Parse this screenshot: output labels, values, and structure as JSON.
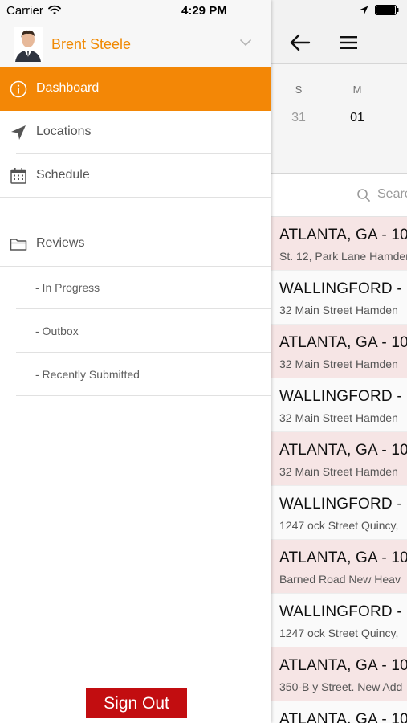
{
  "status_bar": {
    "carrier": "Carrier",
    "time": "4:29 PM"
  },
  "profile": {
    "name": "Brent Steele"
  },
  "nav": {
    "dashboard": "Dashboard",
    "locations": "Locations",
    "schedule": "Schedule",
    "reviews": "Reviews"
  },
  "reviews_sub": {
    "in_progress": "-  In Progress",
    "outbox": "-  Outbox",
    "recently_submitted": "-  Recently Submitted"
  },
  "sign_out": "Sign Out",
  "calendar": {
    "days": [
      {
        "dow": "S",
        "date": "31"
      },
      {
        "dow": "M",
        "date": "01"
      }
    ]
  },
  "search": {
    "placeholder": "Search"
  },
  "sites": [
    {
      "title": "ATLANTA, GA - 10",
      "address": "St. 12,  Park Lane Hamden"
    },
    {
      "title": "WALLINGFORD - ",
      "address": "32 Main Street  Hamden"
    },
    {
      "title": "ATLANTA, GA - 10",
      "address": "32 Main Street  Hamden"
    },
    {
      "title": "WALLINGFORD - ",
      "address": "32 Main Street  Hamden"
    },
    {
      "title": "ATLANTA, GA - 10",
      "address": "32 Main Street  Hamden"
    },
    {
      "title": "WALLINGFORD - ",
      "address": "1247 ock Street  Quincy,"
    },
    {
      "title": "ATLANTA, GA - 10",
      "address": "Barned Road  New Heav"
    },
    {
      "title": "WALLINGFORD - ",
      "address": "1247 ock Street  Quincy,"
    },
    {
      "title": "ATLANTA, GA - 10",
      "address": "350-B y Street. New Add"
    },
    {
      "title": "ATLANTA, GA - 10",
      "address": ""
    }
  ],
  "colors": {
    "accent": "#f38706",
    "sign_out": "#c20d10",
    "row_pink": "#f6e5e5"
  },
  "icons": {
    "wifi": "wifi-icon",
    "location": "location-arrow-icon",
    "battery": "battery-icon",
    "chevron": "chevron-down-icon",
    "dashboard": "info-circle-icon",
    "locations": "navigation-arrow-icon",
    "schedule": "calendar-icon",
    "reviews": "folder-icon",
    "back": "back-arrow-icon",
    "menu": "hamburger-menu-icon",
    "search": "search-icon"
  }
}
